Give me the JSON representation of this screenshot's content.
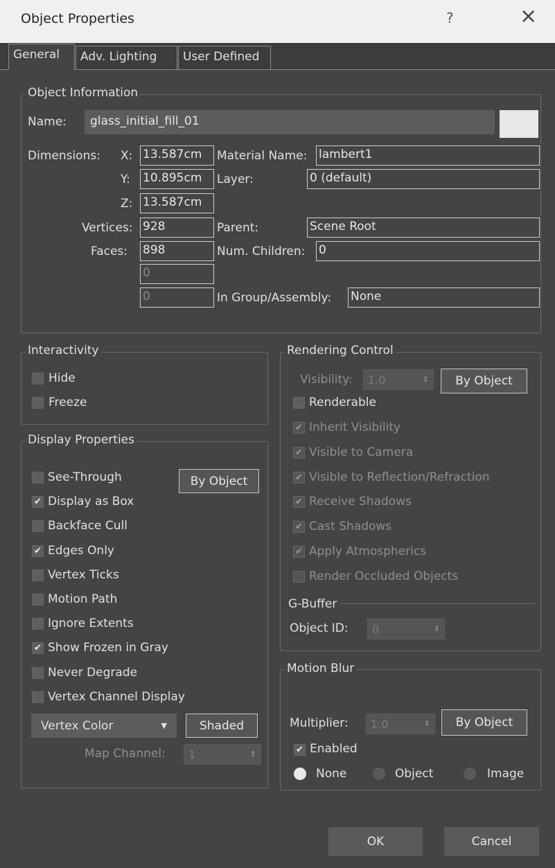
{
  "window": {
    "title": "Object Properties",
    "help": "?",
    "close": "×"
  },
  "tabs": [
    {
      "label": "General"
    },
    {
      "label": "Adv. Lighting"
    },
    {
      "label": "User Defined"
    }
  ],
  "object_info": {
    "title": "Object Information",
    "name_label": "Name:",
    "name_value": "glass_initial_fill_01",
    "dimensions_label": "Dimensions:",
    "x_label": "X:",
    "x_value": "13.587cm",
    "y_label": "Y:",
    "y_value": "10.895cm",
    "z_label": "Z:",
    "z_value": "13.587cm",
    "vertices_label": "Vertices:",
    "vertices_value": "928",
    "faces_label": "Faces:",
    "faces_value": "898",
    "extra1_value": "0",
    "extra2_value": "0",
    "material_label": "Material Name:",
    "material_value": "lambert1",
    "layer_label": "Layer:",
    "layer_value": "0 (default)",
    "parent_label": "Parent:",
    "parent_value": "Scene Root",
    "children_label": "Num. Children:",
    "children_value": "0",
    "group_label": "In Group/Assembly:",
    "group_value": "None"
  },
  "interactivity": {
    "title": "Interactivity",
    "hide": {
      "label": "Hide",
      "checked": false
    },
    "freeze": {
      "label": "Freeze",
      "checked": false
    }
  },
  "display": {
    "title": "Display Properties",
    "by_object": "By Object",
    "items": [
      {
        "label": "See-Through",
        "checked": false
      },
      {
        "label": "Display as Box",
        "checked": true
      },
      {
        "label": "Backface Cull",
        "checked": false
      },
      {
        "label": "Edges Only",
        "checked": true
      },
      {
        "label": "Vertex Ticks",
        "checked": false
      },
      {
        "label": "Motion Path",
        "checked": false
      },
      {
        "label": "Ignore Extents",
        "checked": false
      },
      {
        "label": "Show Frozen in Gray",
        "checked": true
      },
      {
        "label": "Never Degrade",
        "checked": false
      },
      {
        "label": "Vertex Channel Display",
        "checked": false
      }
    ],
    "dropdown_value": "Vertex Color",
    "shaded": "Shaded",
    "map_channel_label": "Map Channel:",
    "map_channel_value": "1"
  },
  "rendering": {
    "title": "Rendering Control",
    "visibility_label": "Visibility:",
    "visibility_value": "1.0",
    "by_object": "By Object",
    "renderable": {
      "label": "Renderable",
      "checked": false
    },
    "items": [
      {
        "label": "Inherit Visibility",
        "checked": true
      },
      {
        "label": "Visible to Camera",
        "checked": true
      },
      {
        "label": "Visible to Reflection/Refraction",
        "checked": true
      },
      {
        "label": "Receive Shadows",
        "checked": true
      },
      {
        "label": "Cast Shadows",
        "checked": true
      },
      {
        "label": "Apply Atmospherics",
        "checked": true
      },
      {
        "label": "Render Occluded Objects",
        "checked": false
      }
    ],
    "gbuffer_title": "G-Buffer",
    "object_id_label": "Object ID:",
    "object_id_value": "0"
  },
  "motion_blur": {
    "title": "Motion Blur",
    "multiplier_label": "Multiplier:",
    "multiplier_value": "1.0",
    "by_object": "By Object",
    "enabled": {
      "label": "Enabled",
      "checked": true
    },
    "radios": [
      {
        "label": "None",
        "selected": true
      },
      {
        "label": "Object",
        "selected": false
      },
      {
        "label": "Image",
        "selected": false
      }
    ]
  },
  "footer": {
    "ok": "OK",
    "cancel": "Cancel"
  },
  "glyphs": {
    "check": "✔",
    "spin": "⇕",
    "caret": "▼"
  }
}
